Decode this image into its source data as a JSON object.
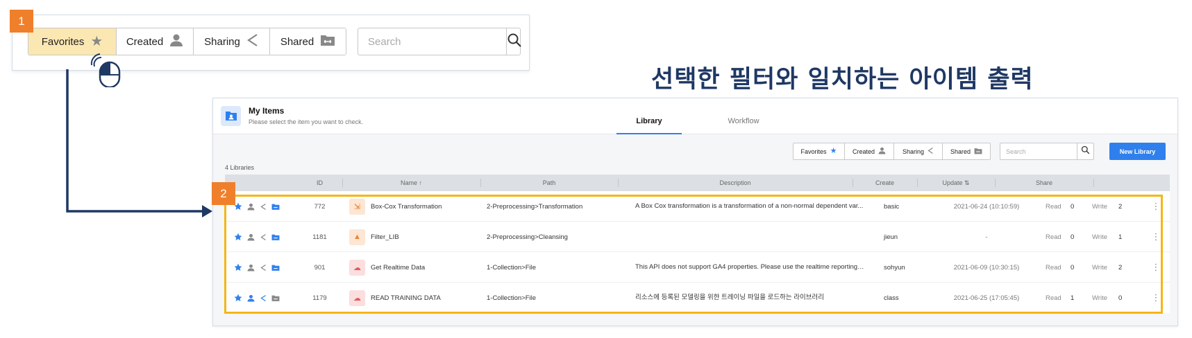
{
  "steps": {
    "one": "1",
    "two": "2"
  },
  "zoom": {
    "filters": [
      {
        "label": "Favorites",
        "icon": "star-icon"
      },
      {
        "label": "Created",
        "icon": "user-icon"
      },
      {
        "label": "Sharing",
        "icon": "share-icon"
      },
      {
        "label": "Shared",
        "icon": "shared-folder-icon"
      }
    ],
    "active_filter": "Favorites",
    "search_placeholder": "Search"
  },
  "headline": "선택한 필터와 일치하는 아이템 출력",
  "window": {
    "title": "My Items",
    "subtitle": "Please select the item you want to check.",
    "tabs": [
      {
        "label": "Library",
        "active": true
      },
      {
        "label": "Workflow",
        "active": false
      }
    ],
    "filters": [
      "Favorites",
      "Created",
      "Sharing",
      "Shared"
    ],
    "search_placeholder": "Search",
    "new_button": "New Library",
    "count": "4 Libraries",
    "columns": {
      "id": "ID",
      "name": "Name ↑",
      "path": "Path",
      "description": "Description",
      "create": "Create",
      "update": "Update ⇅",
      "share": "Share"
    },
    "share_labels": {
      "read": "Read",
      "write": "Write"
    },
    "rows": [
      {
        "id": "772",
        "name": "Box-Cox Transformation",
        "path": "2-Preprocessing>Transformation",
        "description": "A Box Cox transformation is a transformation of a non-normal dependent var...",
        "create": "basic",
        "update": "2021-06-24 (10:10:59)",
        "read": "0",
        "write": "2",
        "type_icon": "transform-icon",
        "icon_color": "#e8843a",
        "icon_bg": "#fde6d3"
      },
      {
        "id": "1181",
        "name": "Filter_LIB",
        "path": "2-Preprocessing>Cleansing",
        "description": "",
        "create": "jieun",
        "update": "-",
        "read": "0",
        "write": "1",
        "type_icon": "cleansing-icon",
        "icon_color": "#e8843a",
        "icon_bg": "#fde6d3"
      },
      {
        "id": "901",
        "name": "Get Realtime Data",
        "path": "1-Collection>File",
        "description": "This API does not support GA4 properties. Please use the realtime reporting ...",
        "create": "sohyun",
        "update": "2021-06-09 (10:30:15)",
        "read": "0",
        "write": "2",
        "type_icon": "cloud-download-icon",
        "icon_color": "#e05a5a",
        "icon_bg": "#fbdede"
      },
      {
        "id": "1179",
        "name": "READ TRAINING DATA",
        "path": "1-Collection>File",
        "description": "리소스에 등록된 모델링을 위한 트레이닝 파일을 로드하는 라이브러리",
        "create": "class",
        "update": "2021-06-25 (17:05:45)",
        "read": "1",
        "write": "0",
        "type_icon": "cloud-download-icon",
        "icon_color": "#e05a5a",
        "icon_bg": "#fbdede"
      }
    ]
  },
  "colors": {
    "accent": "#2f80ed",
    "badge": "#f07f2b",
    "highlight": "#f5b614",
    "connector": "#1f3864",
    "active_filter_bg": "#fbe7b2"
  }
}
